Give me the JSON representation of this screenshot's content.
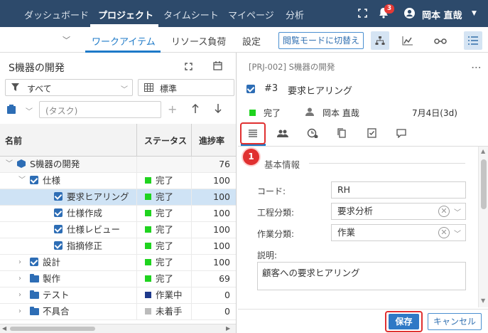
{
  "nav": {
    "items": [
      "ダッシュボード",
      "プロジェクト",
      "タイムシート",
      "マイページ",
      "分析"
    ],
    "notification_count": "3",
    "user_name": "岡本 直哉"
  },
  "subnav": {
    "tabs": [
      "ワークアイテム",
      "リソース負荷",
      "設定"
    ],
    "mode_button": "閲覧モードに切替え"
  },
  "left": {
    "title": "S機器の開発",
    "filter": "すべて",
    "view": "標準",
    "task_placeholder": "(タスク)",
    "columns": [
      "名前",
      "ステータス",
      "進捗率"
    ],
    "rows": [
      {
        "name": "S機器の開発",
        "status": "",
        "progress": "76",
        "kind": "project"
      },
      {
        "name": "仕様",
        "status": "完了",
        "progress": "100",
        "kind": "checked-parent"
      },
      {
        "name": "要求ヒアリング",
        "status": "完了",
        "progress": "100",
        "kind": "checked"
      },
      {
        "name": "仕様作成",
        "status": "完了",
        "progress": "100",
        "kind": "checked"
      },
      {
        "name": "仕様レビュー",
        "status": "完了",
        "progress": "100",
        "kind": "checked"
      },
      {
        "name": "指摘修正",
        "status": "完了",
        "progress": "100",
        "kind": "checked"
      },
      {
        "name": "設計",
        "status": "完了",
        "progress": "100",
        "kind": "checked-collapsed"
      },
      {
        "name": "製作",
        "status": "完了",
        "progress": "69",
        "kind": "folder"
      },
      {
        "name": "テスト",
        "status": "作業中",
        "progress": "0",
        "kind": "folder"
      },
      {
        "name": "不具合",
        "status": "未着手",
        "progress": "0",
        "kind": "folder"
      }
    ]
  },
  "right": {
    "breadcrumb": "[PRJ-002] S機器の開発",
    "item_number": "#3",
    "item_title": "要求ヒアリング",
    "status": "完了",
    "assignee": "岡本 直哉",
    "due": "7月4日(3d)",
    "callout": "1",
    "section_title": "基本情報",
    "fields": {
      "code_label": "コード:",
      "code_value": "RH",
      "process_label": "工程分類:",
      "process_value": "要求分析",
      "work_label": "作業分類:",
      "work_value": "作業",
      "desc_label": "説明:",
      "desc_value": "顧客への要求ヒアリング"
    },
    "save_label": "保存",
    "cancel_label": "キャンセル"
  },
  "colors": {
    "nav_bg": "#2d4a6b",
    "accent": "#1e7ac8",
    "done": "#1fd31f",
    "working": "#1f3a8c",
    "todo": "#bbbbbb",
    "highlight": "#e03030"
  }
}
